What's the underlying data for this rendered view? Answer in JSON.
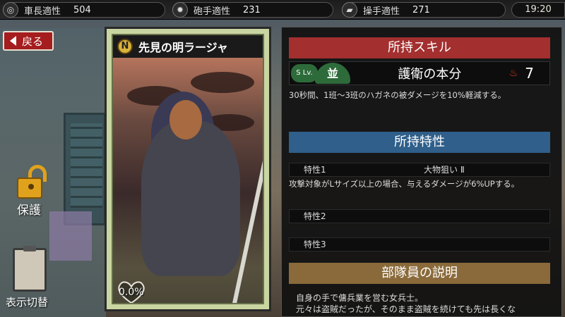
{
  "stats": {
    "commander": {
      "label": "車長適性",
      "value": "504"
    },
    "gunner": {
      "label": "砲手適性",
      "value": "231"
    },
    "driver": {
      "label": "操手適性",
      "value": "271"
    }
  },
  "clock": "19:20",
  "back_label": "戻る",
  "lock_label": "保護",
  "display_toggle_label": "表示切替",
  "card": {
    "rarity": "N",
    "name": "先見の明ラージャ",
    "affection": "0.0%"
  },
  "skill": {
    "header": "所持スキル",
    "slv_label": "S Lv.",
    "grade": "並",
    "name": "護衛の本分",
    "level": "7",
    "description": "30秒間、1班～3班のハガネの被ダメージを10%軽減する。"
  },
  "traits": {
    "header": "所持特性",
    "items": [
      {
        "label": "特性1",
        "value": "大物狙い Ⅱ"
      },
      {
        "label": "特性2",
        "value": ""
      },
      {
        "label": "特性3",
        "value": ""
      }
    ],
    "trait1_description": "攻撃対象がLサイズ以上の場合、与えるダメージが6%UPする。"
  },
  "member": {
    "header": "部隊員の説明",
    "description_line1": "自身の手で傭兵業を営む女兵士。",
    "description_line2": "元々は盗賊だったが、そのまま盗賊を続けても先は長くな"
  }
}
